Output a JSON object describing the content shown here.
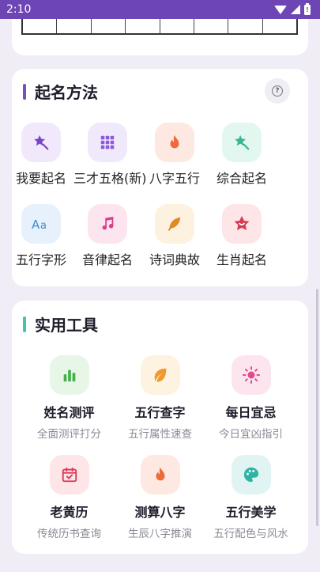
{
  "status_bar": {
    "time": "2:10"
  },
  "methods": {
    "title": "起名方法",
    "accent": "#7b4bc4",
    "items": [
      {
        "label": "我要起名",
        "icon": "star-wand-icon",
        "bg": "#f1e9fb",
        "color": "#7b44c8"
      },
      {
        "label": "三才五格(新)",
        "icon": "grid-icon",
        "bg": "#efe9fb",
        "color": "#8e5be0"
      },
      {
        "label": "八字五行",
        "icon": "flame-icon",
        "bg": "#fde9e1",
        "color": "#ef6a3a"
      },
      {
        "label": "综合起名",
        "icon": "star-wand-icon",
        "bg": "#e2f7ef",
        "color": "#3ab394"
      },
      {
        "label": "五行字形",
        "icon": "text-aa-icon",
        "bg": "#e6f1fb",
        "color": "#3b8bd6"
      },
      {
        "label": "音律起名",
        "icon": "music-note-icon",
        "bg": "#fde5f0",
        "color": "#d9408a"
      },
      {
        "label": "诗词典故",
        "icon": "feather-icon",
        "bg": "#fdf1e0",
        "color": "#e08a24"
      },
      {
        "label": "生肖起名",
        "icon": "smile-star-icon",
        "bg": "#fde5e8",
        "color": "#d83a52"
      }
    ]
  },
  "tools": {
    "title": "实用工具",
    "accent": "#3fc3b5",
    "items": [
      {
        "name": "姓名测评",
        "desc": "全面测评打分",
        "icon": "bar-chart-icon",
        "bg": "#e8f6e8",
        "color": "#44b04a"
      },
      {
        "name": "五行查字",
        "desc": "五行属性速查",
        "icon": "leaf-icon",
        "bg": "#fdf3e0",
        "color": "#ef9a2a"
      },
      {
        "name": "每日宜忌",
        "desc": "今日宜凶指引",
        "icon": "sun-icon",
        "bg": "#fde5f0",
        "color": "#e24a8a"
      },
      {
        "name": "老黄历",
        "desc": "传统历书查询",
        "icon": "calendar-icon",
        "bg": "#fde5e8",
        "color": "#d83a52"
      },
      {
        "name": "测算八字",
        "desc": "生辰八字推演",
        "icon": "flame-icon",
        "bg": "#fde9e1",
        "color": "#ef6a3a"
      },
      {
        "name": "五行美学",
        "desc": "五行配色与风水",
        "icon": "palette-icon",
        "bg": "#e0f5f3",
        "color": "#2fb3a6"
      }
    ]
  }
}
